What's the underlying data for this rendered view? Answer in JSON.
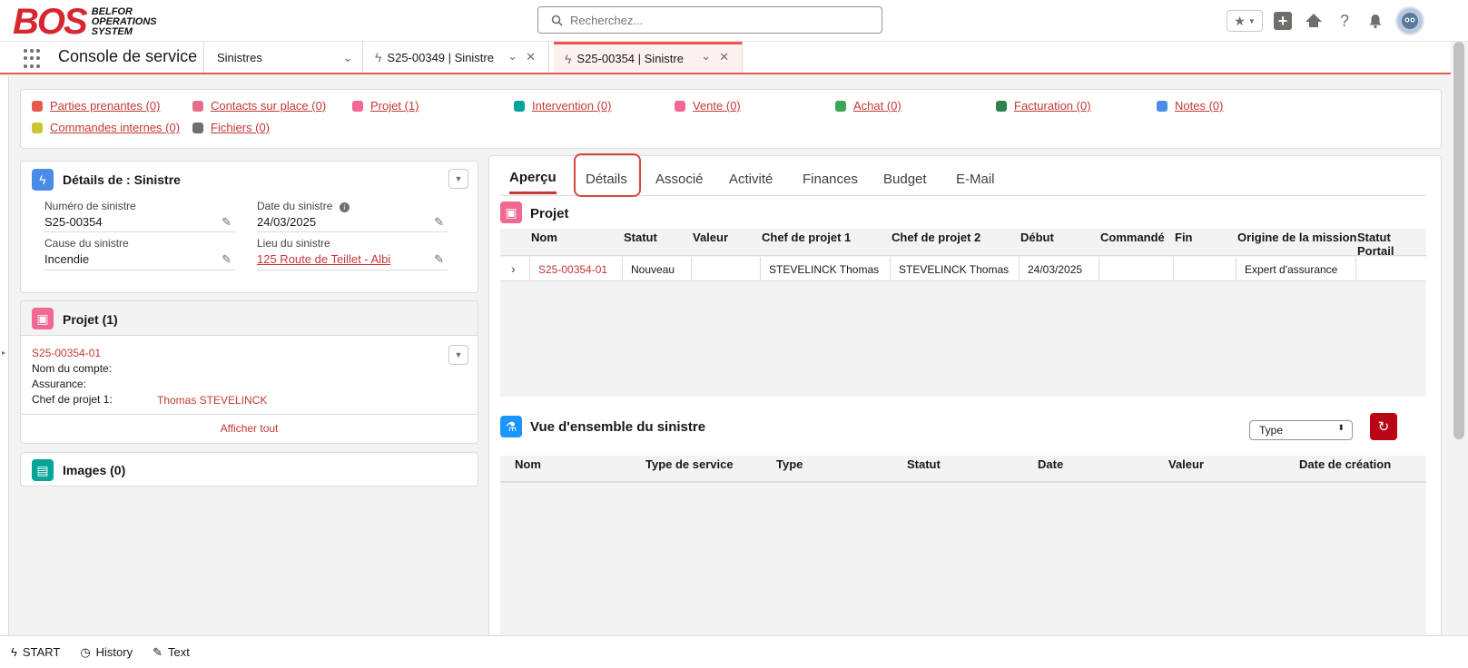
{
  "header": {
    "logo_mark": "BOS",
    "logo_lines": [
      "BELFOR",
      "OPERATIONS",
      "SYSTEM"
    ],
    "search_placeholder": "Recherchez..."
  },
  "nav": {
    "app_name": "Console de service",
    "object_select": "Sinistres",
    "tabs": [
      {
        "label": "S25-00349 | Sinistre",
        "active": false
      },
      {
        "label": "S25-00354 | Sinistre",
        "active": true
      }
    ]
  },
  "related_links": [
    {
      "label": "Parties prenantes (0)",
      "color": "#e9584c"
    },
    {
      "label": "Contacts sur place (0)",
      "color": "#e76d8f"
    },
    {
      "label": "Projet (1)",
      "color": "#f26891"
    },
    {
      "label": "Intervention (0)",
      "color": "#06a59a"
    },
    {
      "label": "Vente (0)",
      "color": "#f26891"
    },
    {
      "label": "Achat (0)",
      "color": "#3ba755"
    },
    {
      "label": "Facturation (0)",
      "color": "#2e844a"
    },
    {
      "label": "Notes (0)",
      "color": "#4b8be8"
    },
    {
      "label": "Commandes internes (0)",
      "color": "#c9c72e"
    },
    {
      "label": "Fichiers (0)",
      "color": "#706e6b"
    }
  ],
  "details_card": {
    "title": "Détails de : Sinistre",
    "fields": [
      {
        "label": "Numéro de sinistre",
        "value": "S25-00354"
      },
      {
        "label": "Date du sinistre",
        "value": "24/03/2025"
      },
      {
        "label": "Cause du sinistre",
        "value": "Incendie"
      },
      {
        "label": "Lieu du sinistre",
        "value": "125 Route de Teillet - Albi"
      }
    ]
  },
  "projet_card": {
    "title": "Projet (1)",
    "record": "S25-00354-01",
    "rows": [
      {
        "label": "Nom du compte:",
        "value": ""
      },
      {
        "label": "Assurance:",
        "value": ""
      },
      {
        "label": "Chef de projet 1:",
        "value": "Thomas STEVELINCK"
      }
    ],
    "view_all": "Afficher tout"
  },
  "images_card": {
    "title": "Images (0)"
  },
  "record_tabs": [
    "Aperçu",
    "Détails",
    "Associé",
    "Activité",
    "Finances",
    "Budget",
    "E-Mail"
  ],
  "projet_table": {
    "title": "Projet",
    "columns": [
      "Nom",
      "Statut",
      "Valeur",
      "Chef de projet 1",
      "Chef de projet 2",
      "Début",
      "Commandé",
      "Fin",
      "Origine de la mission",
      "Statut Portail"
    ],
    "rows": [
      [
        "S25-00354-01",
        "Nouveau",
        "",
        "STEVELINCK Thomas",
        "STEVELINCK Thomas",
        "24/03/2025",
        "",
        "",
        "Expert d'assurance",
        ""
      ]
    ]
  },
  "overview_table": {
    "title": "Vue d'ensemble du sinistre",
    "filter": "Type",
    "columns": [
      "Nom",
      "Type de service",
      "Type",
      "Statut",
      "Date",
      "Valeur",
      "Date de création"
    ]
  },
  "utility_bar": {
    "items": [
      "START",
      "History",
      "Text"
    ]
  }
}
